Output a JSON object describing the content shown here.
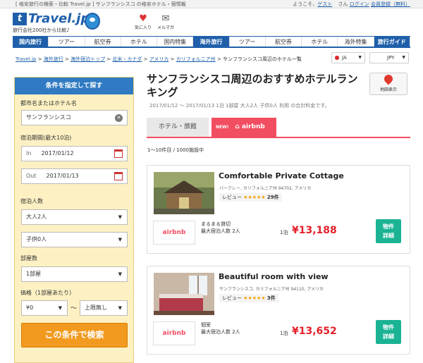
{
  "topbar": {
    "left": "[ 格安旅行の検索・比較 Travel.jp ] サンフランシスコ の格安ホテル・宿情報",
    "welcome": "ようこそ、",
    "guest": "ゲスト",
    "san": " さん",
    "login": "ログイン",
    "register": "会員登録（無料）"
  },
  "header": {
    "logo": "Travel.jp",
    "logo_badge": "t",
    "tagline": "旅行会社200社から比較♪",
    "fav_label": "気に入り",
    "mail_label": "メルマガ"
  },
  "nav": [
    "国内旅行",
    "ツアー",
    "航空券",
    "ホテル",
    "国内特集",
    "海外旅行",
    "ツアー",
    "航空券",
    "ホテル",
    "海外特集",
    "旅行ガイド"
  ],
  "breadcrumb": [
    "Travel.jp",
    "海外旅行",
    "海外宿泊トップ",
    "北米・カナダ",
    "アメリカ",
    "カリフォルニア州",
    "サンフランシスコ周辺のホテル一覧"
  ],
  "selectors": {
    "lang": "JA",
    "currency": "JPY"
  },
  "search": {
    "header": "条件を指定して探す",
    "city_label": "都市名またはホテル名",
    "city_value": "サンフランシスコ",
    "period_label": "宿泊期間(最大10泊)",
    "in_label": "In",
    "in_date": "2017/01/12",
    "out_label": "Out",
    "out_date": "2017/01/13",
    "guests_label": "宿泊人数",
    "adults": "大人2人",
    "children": "子供0人",
    "rooms_label": "部屋数",
    "rooms": "1部屋",
    "price_label": "価格（1部屋あたり）",
    "price_min": "¥0",
    "tilde": "〜",
    "price_max": "上限無し",
    "button": "この条件で検索"
  },
  "main": {
    "title": "サンフランシスコ周辺のおすすめホテルランキング",
    "map_label": "地図表示",
    "subinfo": "2017/01/12 〜 2017/01/13 1泊 1部屋 大人2人 子供0人 利用 の合計料金です。",
    "tab_hotel": "ホテル・旅館",
    "tab_new": "NEW!",
    "tab_airbnb": "airbnb",
    "count": "1〜10件目 / 1000施設中"
  },
  "listings": [
    {
      "name": "Comfortable Private Cottage",
      "address": "バークレー, カリフォルニア州 94702, アメリカ",
      "review_label": "レビュー",
      "stars": "★★★★★",
      "review_count": "29件",
      "provider": "airbnb",
      "room_type": "まるまる貸切",
      "capacity": "最大宿泊人数 2人",
      "per": "1泊",
      "price": "¥13,188",
      "detail_1": "物件",
      "detail_2": "詳細"
    },
    {
      "name": "Beautiful room with view",
      "address": "サンフランシスコ, カリフォルニア州 94110, アメリカ",
      "review_label": "レビュー",
      "stars": "★★★★★",
      "review_count": "3件",
      "provider": "airbnb",
      "room_type": "個室",
      "capacity": "最大宿泊人数 2人",
      "per": "1泊",
      "price": "¥13,652",
      "detail_1": "物件",
      "detail_2": "詳細"
    }
  ],
  "colors": {
    "brand": "#1f5faa",
    "airbnb": "#f24e62",
    "search_button": "#f29a1f",
    "detail_button": "#1ab394",
    "price": "#e5202b",
    "panel": "#fdf1c3"
  }
}
